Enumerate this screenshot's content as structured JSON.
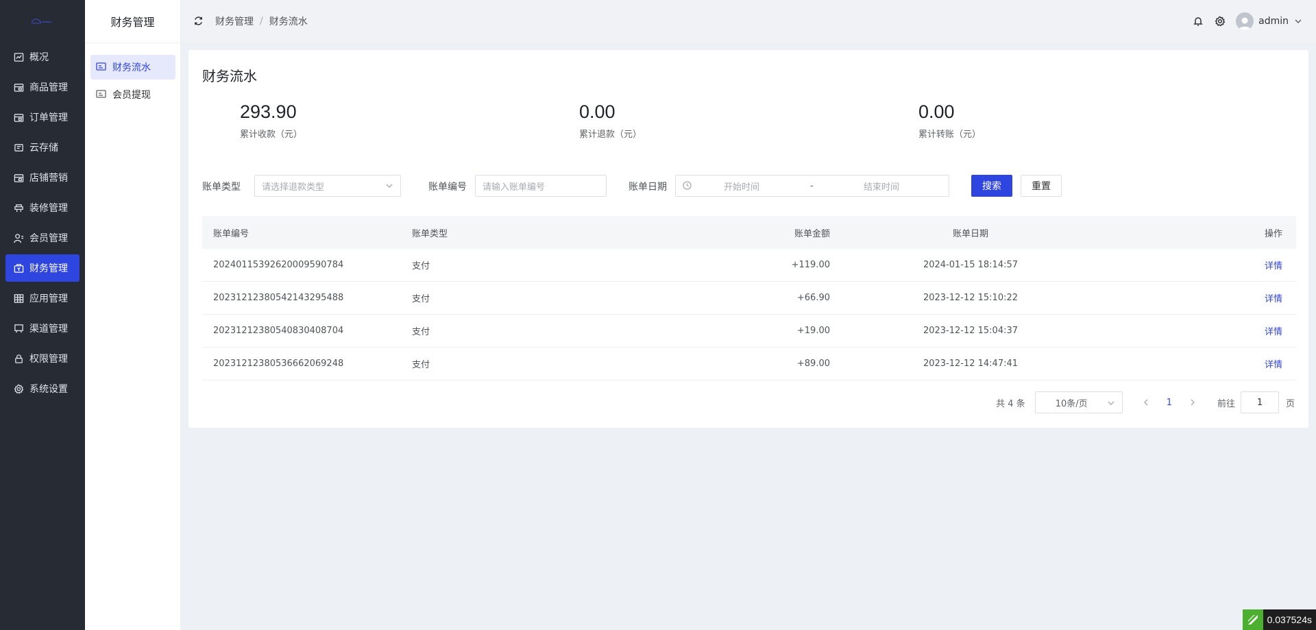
{
  "nav": {
    "items": [
      {
        "label": "概况",
        "icon": "chart-line-icon"
      },
      {
        "label": "商品管理",
        "icon": "goods-icon"
      },
      {
        "label": "订单管理",
        "icon": "order-icon"
      },
      {
        "label": "云存储",
        "icon": "cloud-storage-icon"
      },
      {
        "label": "店铺营销",
        "icon": "shop-icon"
      },
      {
        "label": "装修管理",
        "icon": "decoration-icon"
      },
      {
        "label": "会员管理",
        "icon": "member-icon"
      },
      {
        "label": "财务管理",
        "icon": "finance-icon"
      },
      {
        "label": "应用管理",
        "icon": "app-grid-icon"
      },
      {
        "label": "渠道管理",
        "icon": "channel-icon"
      },
      {
        "label": "权限管理",
        "icon": "lock-icon"
      },
      {
        "label": "系统设置",
        "icon": "gear-icon"
      }
    ],
    "active_index": 7,
    "accent": "#2f45e0"
  },
  "subnav": {
    "title": "财务管理",
    "items": [
      {
        "label": "财务流水"
      },
      {
        "label": "会员提现"
      }
    ]
  },
  "header": {
    "breadcrumb": [
      "财务管理",
      "财务流水"
    ],
    "breadcrumb_sep": "/",
    "user": "admin"
  },
  "page": {
    "title": "财务流水",
    "stats": [
      {
        "value": "293.90",
        "label": "累计收款（元）"
      },
      {
        "value": "0.00",
        "label": "累计退款（元）"
      },
      {
        "value": "0.00",
        "label": "累计转账（元）"
      }
    ]
  },
  "filters": {
    "type_label": "账单类型",
    "type_placeholder": "请选择退款类型",
    "no_label": "账单编号",
    "no_placeholder": "请输入账单编号",
    "date_label": "账单日期",
    "date_start_placeholder": "开始时间",
    "date_sep": "-",
    "date_end_placeholder": "结束时间",
    "search_label": "搜索",
    "reset_label": "重置"
  },
  "table": {
    "columns": [
      "账单编号",
      "账单类型",
      "账单金额",
      "账单日期",
      "操作"
    ],
    "rows": [
      {
        "no": "20240115392620009590784",
        "type": "支付",
        "amount": "+119.00",
        "date": "2024-01-15 18:14:57",
        "action": "详情"
      },
      {
        "no": "20231212380542143295488",
        "type": "支付",
        "amount": "+66.90",
        "date": "2023-12-12 15:10:22",
        "action": "详情"
      },
      {
        "no": "20231212380540830408704",
        "type": "支付",
        "amount": "+19.00",
        "date": "2023-12-12 15:04:37",
        "action": "详情"
      },
      {
        "no": "20231212380536662069248",
        "type": "支付",
        "amount": "+89.00",
        "date": "2023-12-12 14:47:41",
        "action": "详情"
      }
    ]
  },
  "pagination": {
    "total_text": "共 4 条",
    "page_size": "10条/页",
    "current_page": "1",
    "goto_label": "前往",
    "goto_value": "1",
    "page_suffix": "页"
  },
  "timer": {
    "value": "0.037524s"
  }
}
